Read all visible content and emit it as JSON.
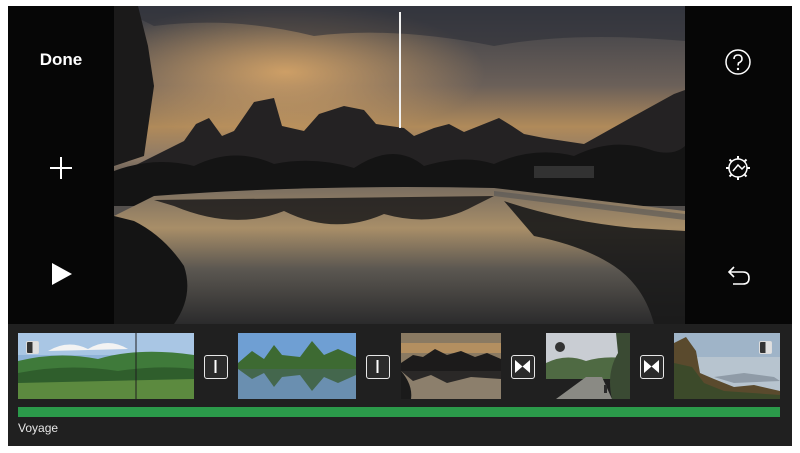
{
  "toolbar": {
    "done_label": "Done",
    "left_icons": [
      "plus-icon",
      "play-icon"
    ],
    "right_icons": [
      "help-icon",
      "settings-icon",
      "undo-icon"
    ]
  },
  "timeline": {
    "clips": [
      {
        "scene": "green-hills"
      },
      {
        "scene": "karst-river"
      },
      {
        "scene": "sunset-lake"
      },
      {
        "scene": "mountain-road"
      },
      {
        "scene": "cliff-valley"
      }
    ],
    "transitions": [
      "cut-icon",
      "cut-icon",
      "bowtie-icon",
      "bowtie-icon"
    ],
    "audio_track": {
      "label": "Voyage",
      "color": "#2b9a4a"
    }
  },
  "colors": {
    "background": "#1f1f1f",
    "side_panels": "#060606",
    "audio": "#2b9a4a",
    "playhead": "#f2f2f2"
  }
}
